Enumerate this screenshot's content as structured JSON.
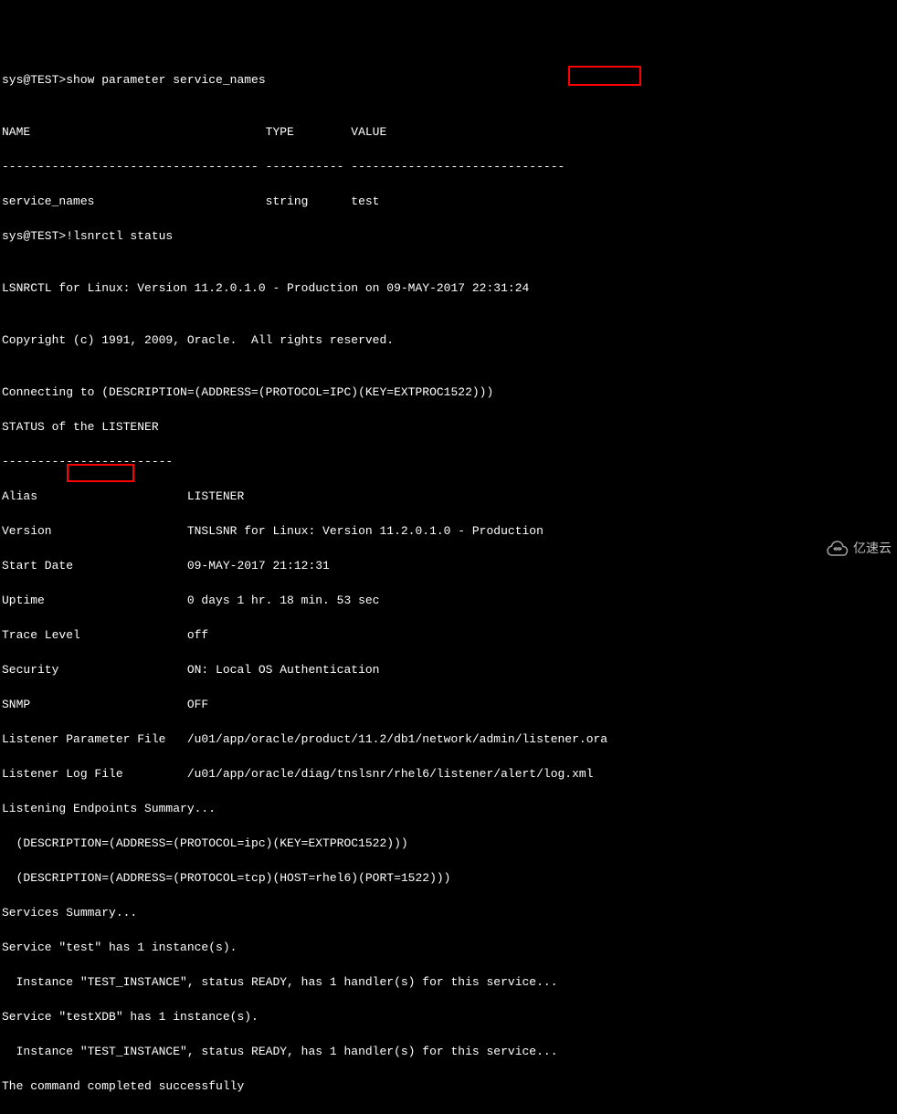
{
  "prompt1": "sys@TEST>show parameter service_names",
  "header_name": "NAME                                 TYPE        VALUE",
  "header_sep": "------------------------------------ ----------- ------------------------------",
  "param_row": "service_names                        string      test",
  "prompt2": "sys@TEST>!lsnrctl status",
  "blank": "",
  "lsnrctl_banner": "LSNRCTL for Linux: Version 11.2.0.1.0 - Production on 09-MAY-2017 22:31:24",
  "copyright": "Copyright (c) 1991, 2009, Oracle.  All rights reserved.",
  "connecting": "Connecting to (DESCRIPTION=(ADDRESS=(PROTOCOL=IPC)(KEY=EXTPROC1522)))",
  "status_hdr": "STATUS of the LISTENER",
  "status_sep": "------------------------",
  "alias": "Alias                     LISTENER",
  "version": "Version                   TNSLSNR for Linux: Version 11.2.0.1.0 - Production",
  "startdate": "Start Date                09-MAY-2017 21:12:31",
  "uptime": "Uptime                    0 days 1 hr. 18 min. 53 sec",
  "trace": "Trace Level               off",
  "security": "Security                  ON: Local OS Authentication",
  "snmp": "SNMP                      OFF",
  "paramfile": "Listener Parameter File   /u01/app/oracle/product/11.2/db1/network/admin/listener.ora",
  "logfile": "Listener Log File         /u01/app/oracle/diag/tnslsnr/rhel6/listener/alert/log.xml",
  "endpoints_hdr": "Listening Endpoints Summary...",
  "endpoint1": "  (DESCRIPTION=(ADDRESS=(PROTOCOL=ipc)(KEY=EXTPROC1522)))",
  "endpoint2": "  (DESCRIPTION=(ADDRESS=(PROTOCOL=tcp)(HOST=rhel6)(PORT=1522)))",
  "services_hdr": "Services Summary...",
  "service1": "Service \"test\" has 1 instance(s).",
  "instance1": "  Instance \"TEST_INSTANCE\", status READY, has 1 handler(s) for this service...",
  "service2": "Service \"testXDB\" has 1 instance(s).",
  "instance2": "  Instance \"TEST_INSTANCE\", status READY, has 1 handler(s) for this service...",
  "completed": "The command completed successfully",
  "watermark_text": "亿速云"
}
